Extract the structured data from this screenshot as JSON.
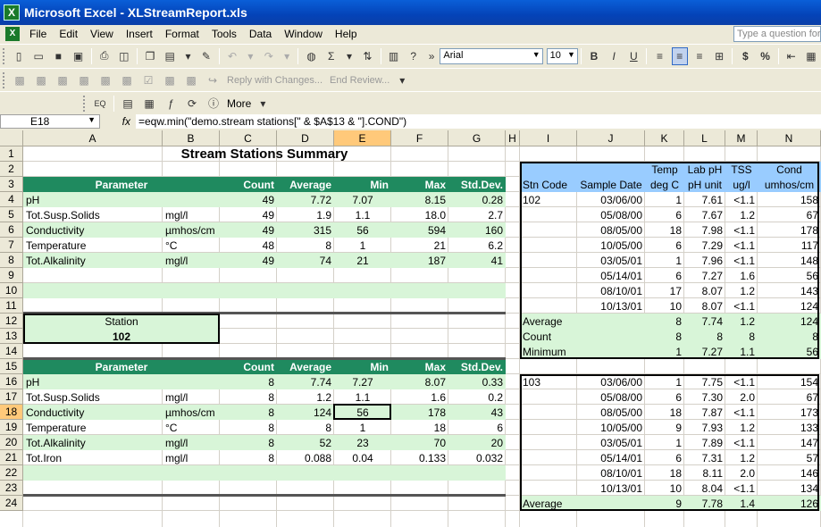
{
  "window": {
    "title": "Microsoft Excel - XLStreamReport.xls"
  },
  "menu": [
    "File",
    "Edit",
    "View",
    "Insert",
    "Format",
    "Tools",
    "Data",
    "Window",
    "Help"
  ],
  "question_placeholder": "Type a question for",
  "toolbar": {
    "font": "Arial",
    "size": "10",
    "bold": "B",
    "italic": "I",
    "underline": "U",
    "currency": "$",
    "percent": "%"
  },
  "review": {
    "reply": "Reply with Changes...",
    "end": "End Review...",
    "more": "More"
  },
  "formula_bar": {
    "name_box": "E18",
    "fx": "fx",
    "formula": "=eqw.min(\"demo.stream stations[\" & $A$13 & \"].COND\")"
  },
  "columns": [
    "A",
    "B",
    "C",
    "D",
    "E",
    "F",
    "G",
    "H",
    "I",
    "J",
    "K",
    "L",
    "M",
    "N"
  ],
  "rows": [
    "1",
    "2",
    "3",
    "4",
    "5",
    "6",
    "7",
    "8",
    "9",
    "10",
    "11",
    "12",
    "13",
    "14",
    "15",
    "16",
    "17",
    "18",
    "19",
    "20",
    "21",
    "22",
    "23",
    "24"
  ],
  "sheet": {
    "title": "Stream Stations Summary",
    "headers": [
      "Parameter",
      "Count",
      "Average",
      "Min",
      "Max",
      "Std.Dev."
    ],
    "summary": [
      [
        "pH",
        "",
        "49",
        "7.72",
        "7.07",
        "8.15",
        "0.28"
      ],
      [
        "Tot.Susp.Solids",
        "mgl/l",
        "49",
        "1.9",
        "1.1",
        "18.0",
        "2.7"
      ],
      [
        "Conductivity",
        "µmhos/cm",
        "49",
        "315",
        "56",
        "594",
        "160"
      ],
      [
        "Temperature",
        "°C",
        "48",
        "8",
        "1",
        "21",
        "6.2"
      ],
      [
        "Tot.Alkalinity",
        "mgl/l",
        "49",
        "74",
        "21",
        "187",
        "41"
      ]
    ],
    "station_label": "Station",
    "station_value": "102",
    "station_rows": [
      [
        "pH",
        "",
        "8",
        "7.74",
        "7.27",
        "8.07",
        "0.33"
      ],
      [
        "Tot.Susp.Solids",
        "mgl/l",
        "8",
        "1.2",
        "1.1",
        "1.6",
        "0.2"
      ],
      [
        "Conductivity",
        "µmhos/cm",
        "8",
        "124",
        "56",
        "178",
        "43"
      ],
      [
        "Temperature",
        "°C",
        "8",
        "8",
        "1",
        "18",
        "6"
      ],
      [
        "Tot.Alkalinity",
        "mgl/l",
        "8",
        "52",
        "23",
        "70",
        "20"
      ],
      [
        "Tot.Iron",
        "mgl/l",
        "8",
        "0.088",
        "0.04",
        "0.133",
        "0.032"
      ]
    ],
    "right_headers_top": [
      "",
      "",
      "Temp",
      "Lab pH",
      "TSS",
      "Cond"
    ],
    "right_headers_bottom": [
      "Stn Code",
      "Sample Date",
      "deg C",
      "pH unit",
      "ug/l",
      "umhos/cm"
    ],
    "stn102": [
      [
        "102",
        "03/06/00",
        "1",
        "7.61",
        "<1.1",
        "158"
      ],
      [
        "",
        "05/08/00",
        "6",
        "7.67",
        "1.2",
        "67"
      ],
      [
        "",
        "08/05/00",
        "18",
        "7.98",
        "<1.1",
        "178"
      ],
      [
        "",
        "10/05/00",
        "6",
        "7.29",
        "<1.1",
        "117"
      ],
      [
        "",
        "03/05/01",
        "1",
        "7.96",
        "<1.1",
        "148"
      ],
      [
        "",
        "05/14/01",
        "6",
        "7.27",
        "1.6",
        "56"
      ],
      [
        "",
        "08/10/01",
        "17",
        "8.07",
        "1.2",
        "143"
      ],
      [
        "",
        "10/13/01",
        "10",
        "8.07",
        "<1.1",
        "124"
      ]
    ],
    "stn102_stats": [
      [
        "Average",
        "",
        "8",
        "7.74",
        "1.2",
        "124"
      ],
      [
        "Count",
        "",
        "8",
        "8",
        "8",
        "8"
      ],
      [
        "Minimum",
        "",
        "1",
        "7.27",
        "1.1",
        "56"
      ]
    ],
    "stn103": [
      [
        "103",
        "03/06/00",
        "1",
        "7.75",
        "<1.1",
        "154"
      ],
      [
        "",
        "05/08/00",
        "6",
        "7.30",
        "2.0",
        "67"
      ],
      [
        "",
        "08/05/00",
        "18",
        "7.87",
        "<1.1",
        "173"
      ],
      [
        "",
        "10/05/00",
        "9",
        "7.93",
        "1.2",
        "133"
      ],
      [
        "",
        "03/05/01",
        "1",
        "7.89",
        "<1.1",
        "147"
      ],
      [
        "",
        "05/14/01",
        "6",
        "7.31",
        "1.2",
        "57"
      ],
      [
        "",
        "08/10/01",
        "18",
        "8.11",
        "2.0",
        "146"
      ],
      [
        "",
        "10/13/01",
        "10",
        "8.04",
        "<1.1",
        "134"
      ]
    ],
    "stn103_stats": [
      [
        "Average",
        "",
        "9",
        "7.78",
        "1.4",
        "126"
      ]
    ]
  }
}
